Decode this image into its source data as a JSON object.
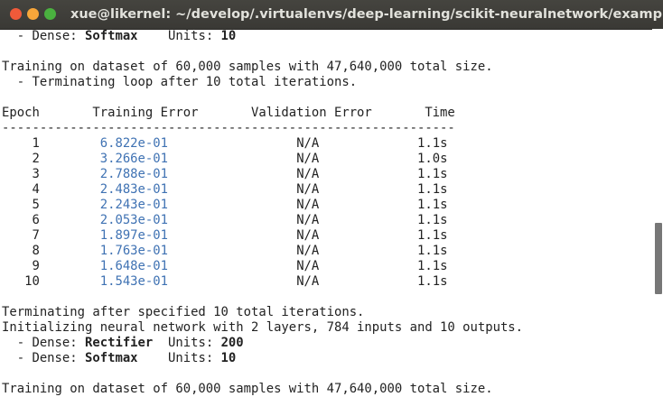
{
  "window": {
    "title": "xue@likernel: ~/develop/.virtualenvs/deep-learning/scikit-neuralnetwork/examples"
  },
  "terminal": {
    "dense1": {
      "prefix": "  - Dense: ",
      "type": "Softmax",
      "units_label": "    Units: ",
      "units": "10"
    },
    "training1": "Training on dataset of 60,000 samples with 47,640,000 total size.",
    "terminating_loop": "  - Terminating loop after 10 total iterations.",
    "table": {
      "header": "Epoch       Training Error       Validation Error       Time",
      "divider": "------------------------------------------------------------",
      "rows": [
        {
          "epoch": "    1",
          "train": "6.822e-01",
          "valid": "N/A",
          "time": "1.1s"
        },
        {
          "epoch": "    2",
          "train": "3.266e-01",
          "valid": "N/A",
          "time": "1.0s"
        },
        {
          "epoch": "    3",
          "train": "2.788e-01",
          "valid": "N/A",
          "time": "1.1s"
        },
        {
          "epoch": "    4",
          "train": "2.483e-01",
          "valid": "N/A",
          "time": "1.1s"
        },
        {
          "epoch": "    5",
          "train": "2.243e-01",
          "valid": "N/A",
          "time": "1.1s"
        },
        {
          "epoch": "    6",
          "train": "2.053e-01",
          "valid": "N/A",
          "time": "1.1s"
        },
        {
          "epoch": "    7",
          "train": "1.897e-01",
          "valid": "N/A",
          "time": "1.1s"
        },
        {
          "epoch": "    8",
          "train": "1.763e-01",
          "valid": "N/A",
          "time": "1.1s"
        },
        {
          "epoch": "    9",
          "train": "1.648e-01",
          "valid": "N/A",
          "time": "1.1s"
        },
        {
          "epoch": "   10",
          "train": "1.543e-01",
          "valid": "N/A",
          "time": "1.1s"
        }
      ]
    },
    "terminating_after": "Terminating after specified 10 total iterations.",
    "initializing": "Initializing neural network with 2 layers, 784 inputs and 10 outputs.",
    "dense_a": {
      "prefix": "  - Dense: ",
      "type": "Rectifier",
      "units_label": "  Units: ",
      "units": "200"
    },
    "dense_b": {
      "prefix": "  - Dense: ",
      "type": "Softmax",
      "units_label": "    Units: ",
      "units": "10"
    },
    "training2": "Training on dataset of 60,000 samples with 47,640,000 total size."
  }
}
